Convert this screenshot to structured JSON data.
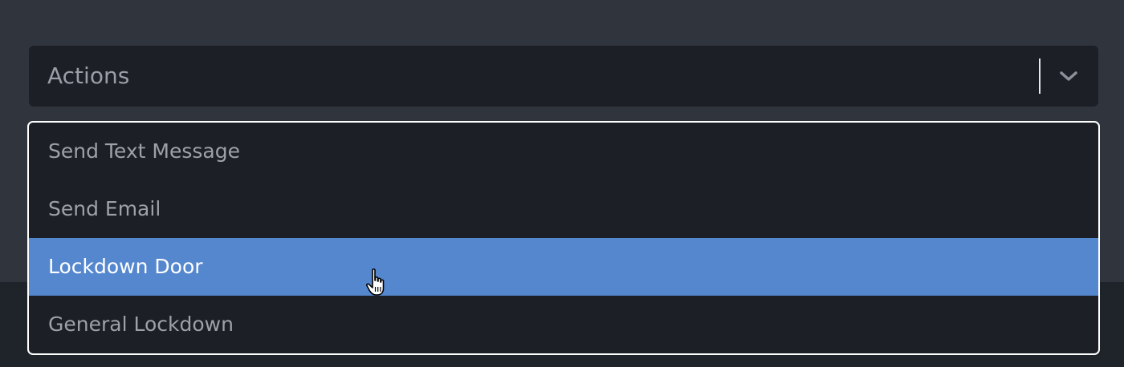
{
  "select": {
    "value": "Actions",
    "chevron_icon": "chevron-down-icon"
  },
  "menu": {
    "options": [
      {
        "label": "Send Text Message",
        "highlighted": false
      },
      {
        "label": "Send Email",
        "highlighted": false
      },
      {
        "label": "Lockdown Door",
        "highlighted": true
      },
      {
        "label": "General Lockdown",
        "highlighted": false
      }
    ]
  },
  "cursor": {
    "icon": "hand-pointer-icon"
  },
  "colors": {
    "page_background": "#30353d",
    "control_background": "#1c1f26",
    "highlight": "#5587cf",
    "menu_border": "#ffffff"
  }
}
